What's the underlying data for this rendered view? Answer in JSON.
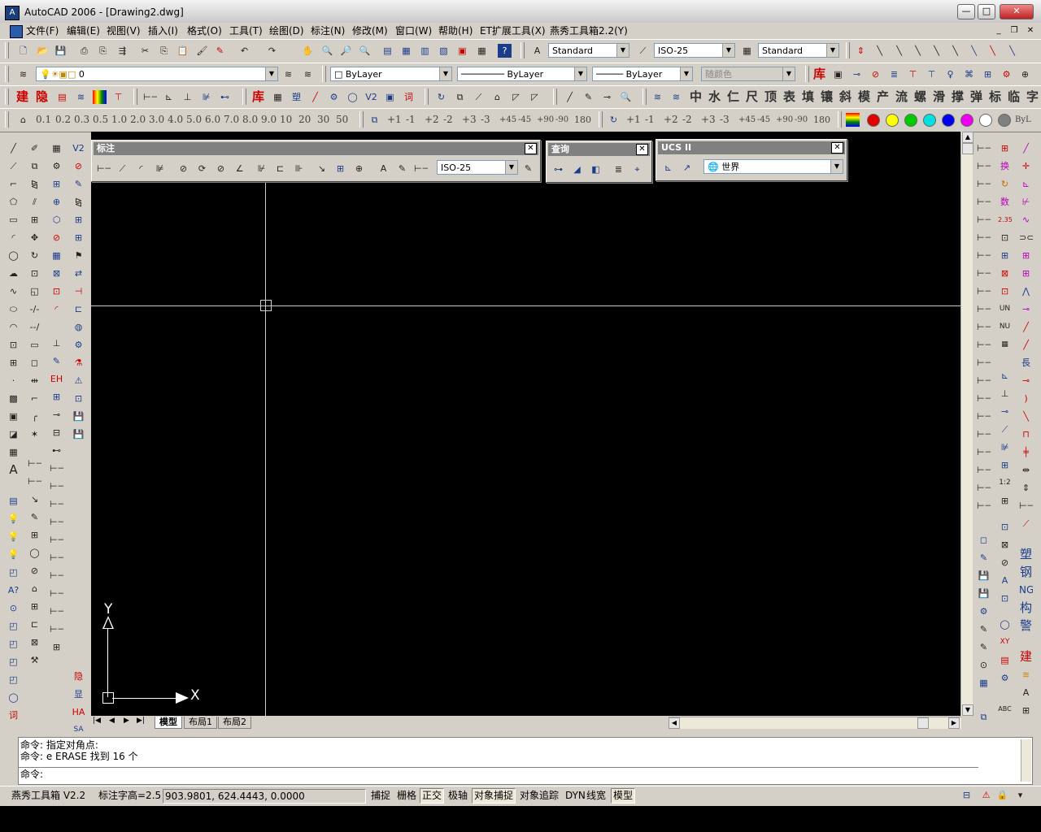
{
  "window": {
    "title": "AutoCAD 2006 - [Drawing2.dwg]",
    "min_label": "—",
    "max_label": "□",
    "close_label": "✕"
  },
  "menu": [
    "文件(F)",
    "编辑(E)",
    "视图(V)",
    "插入(I)",
    "格式(O)",
    "工具(T)",
    "绘图(D)",
    "标注(N)",
    "修改(M)",
    "窗口(W)",
    "帮助(H)",
    "ET扩展工具(X)",
    "燕秀工具箱2.2(Y)"
  ],
  "mdi_buttons": [
    "_",
    "❐",
    "✕"
  ],
  "styles_toolbar": {
    "text_style": "Standard",
    "dim_style": "ISO-25",
    "table_style": "Standard"
  },
  "layers_toolbar": {
    "layer": "0",
    "color": "ByLayer",
    "linetype": "ByLayer",
    "lineweight": "ByLayer",
    "plotstyle": "随颜色"
  },
  "cn_toolbar_left": [
    "建",
    "隐"
  ],
  "cn_toolbar_right": [
    "库",
    "中",
    "水",
    "仁",
    "尺",
    "顶",
    "表",
    "填",
    "镶",
    "斜",
    "模",
    "产",
    "流",
    "螺",
    "滑",
    "撑",
    "弹",
    "标",
    "临",
    "字"
  ],
  "scale_buttons": [
    "0.1",
    "0.2",
    "0.3",
    "0.5",
    "1.0",
    "2.0",
    "3.0",
    "4.0",
    "5.0",
    "6.0",
    "7.0",
    "8.0",
    "9.0",
    "10",
    "20",
    "30",
    "50"
  ],
  "rotate_buttons_a": [
    "+1",
    "-1",
    "+2",
    "-2",
    "+3",
    "-3",
    "+45",
    "-45",
    "+90",
    "-90",
    "180"
  ],
  "rotate_buttons_b": [
    "+1",
    "-1",
    "+2",
    "-2",
    "+3",
    "-3",
    "+45",
    "-45",
    "+90",
    "-90",
    "180"
  ],
  "colors": [
    "#e00000",
    "#ffff00",
    "#00cc00",
    "#00e0e0",
    "#0000ee",
    "#ee00ee",
    "#ffffff",
    "#808080"
  ],
  "color_bylayer": "ByL",
  "dim_panel": {
    "title": "标注",
    "dim_style": "ISO-25"
  },
  "query_panel": {
    "title": "查询"
  },
  "ucs_panel": {
    "title": "UCS II",
    "ucs": "世界"
  },
  "right_cn_bottom": [
    "塑",
    "钢",
    "NG",
    "构",
    "警",
    "建"
  ],
  "right_cn_top": [
    "换",
    "数"
  ],
  "ucs_icon": {
    "x_label": "X",
    "y_label": "Y"
  },
  "layout_tabs": [
    "模型",
    "布局1",
    "布局2"
  ],
  "command_lines": [
    "命令: 指定对角点:",
    "命令: e ERASE 找到 16 个",
    "命令:"
  ],
  "status": {
    "tool": "燕秀工具箱 V2.2",
    "dim_height": "标注字高=2.5",
    "coords": "903.9801, 624.4443, 0.0000",
    "toggles": [
      "捕捉",
      "栅格",
      "正交",
      "极轴",
      "对象捕捉",
      "对象追踪",
      "DYN",
      "线宽",
      "模型"
    ],
    "toggles_on": [
      "正交",
      "对象捕捉",
      "模型"
    ]
  },
  "left_cn_icons": [
    "词",
    "HA",
    "隐",
    "显",
    "SA"
  ]
}
